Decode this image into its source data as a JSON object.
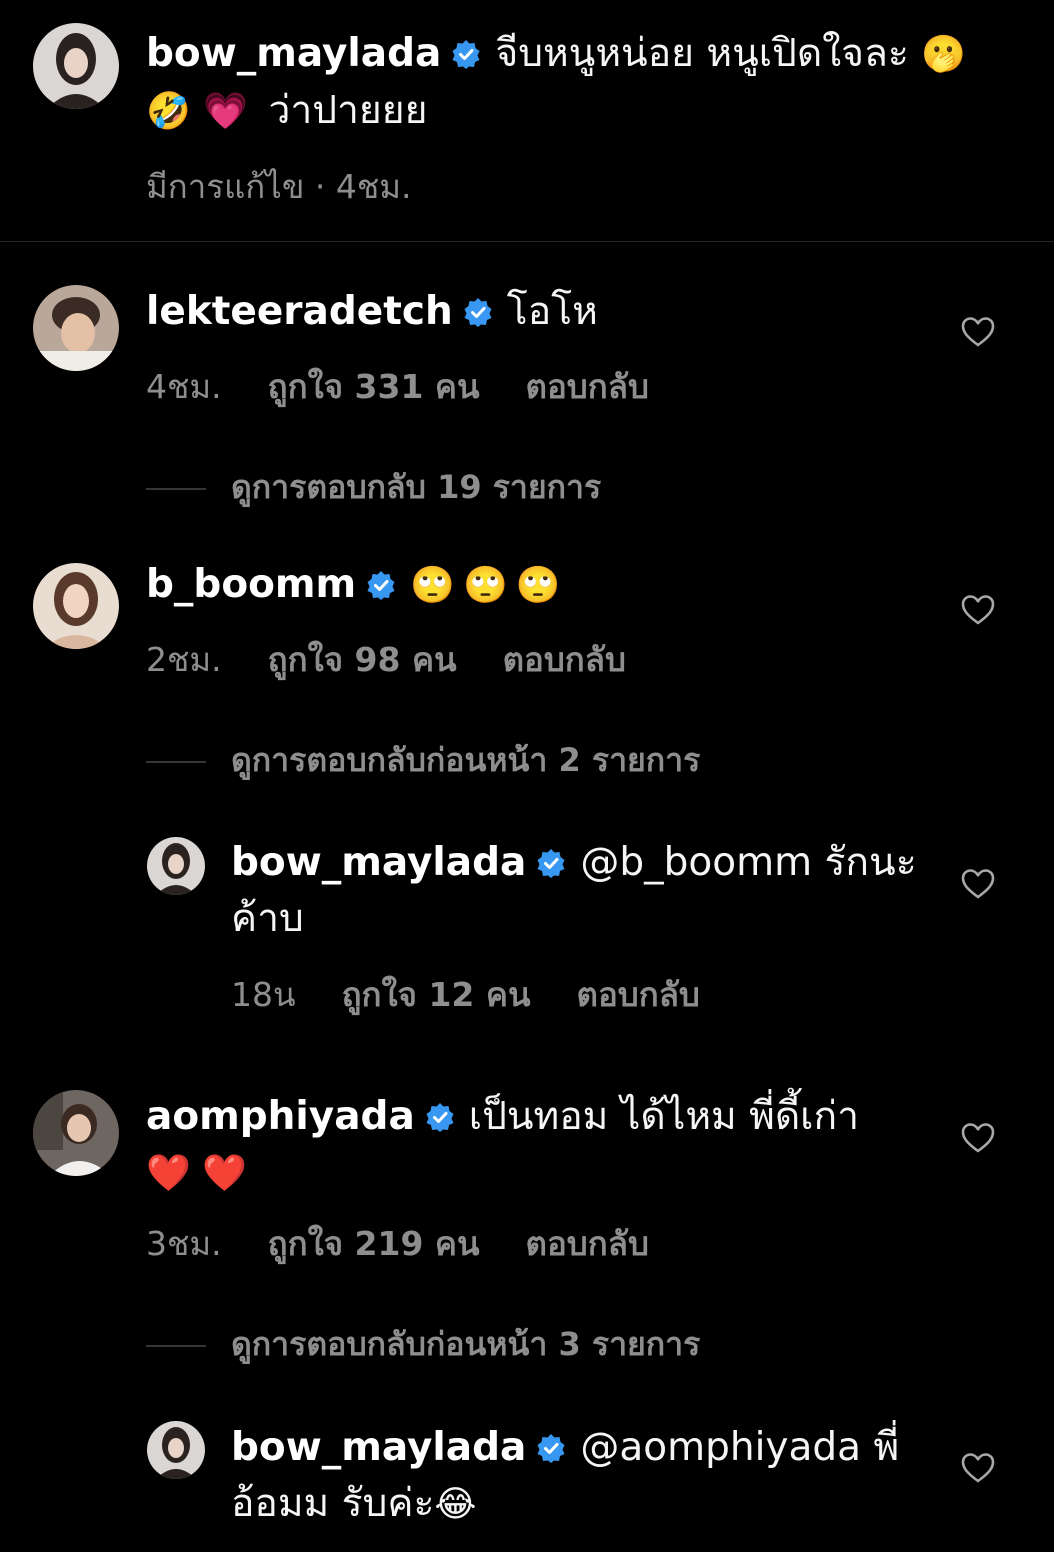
{
  "colors": {
    "background": "#000000",
    "primary_text": "#f5f5f5",
    "secondary_text": "#8e8e8e",
    "verified_badge": "#3897f0",
    "divider": "#262626"
  },
  "caption": {
    "username": "bow_maylada",
    "text_line1": "จีบหนูหน่อย หนูเปิดใจละ",
    "emoji_1": "🫢",
    "emoji_2": "🤣",
    "emoji_3": "💗",
    "text_line2": "ว่าปายยย",
    "meta": "มีการแก้ไข · 4ชม."
  },
  "comments": [
    {
      "username": "lekteeradetch",
      "text": "โอโห",
      "time": "4ชม.",
      "likes": "ถูกใจ 331 คน",
      "reply": "ตอบกลับ",
      "view_replies": "ดูการตอบกลับ 19 รายการ"
    },
    {
      "username": "b_boomm",
      "emoji": "🙄🙄🙄",
      "time": "2ชม.",
      "likes": "ถูกใจ 98 คน",
      "reply": "ตอบกลับ",
      "view_replies": "ดูการตอบกลับก่อนหน้า 2 รายการ",
      "nested_reply": {
        "username": "bow_maylada",
        "mention": "@b_boomm",
        "text_line1": "รักนะ",
        "text_line2": "ค้าบ",
        "time": "18น",
        "likes": "ถูกใจ 12 คน",
        "reply": "ตอบกลับ"
      }
    },
    {
      "username": "aomphiyada",
      "text": "เป็นทอม ได้ไหม พี่ดี้เก่า",
      "emoji": "❤️ ❤️",
      "time": "3ชม.",
      "likes": "ถูกใจ 219 คน",
      "reply": "ตอบกลับ",
      "view_replies": "ดูการตอบกลับก่อนหน้า 3 รายการ",
      "nested_reply": {
        "username": "bow_maylada",
        "mention": "@aomphiyada",
        "text_line1": "พี่",
        "text_line2": "อ้อมม รับค่ะ",
        "emoji": "😂"
      }
    }
  ]
}
